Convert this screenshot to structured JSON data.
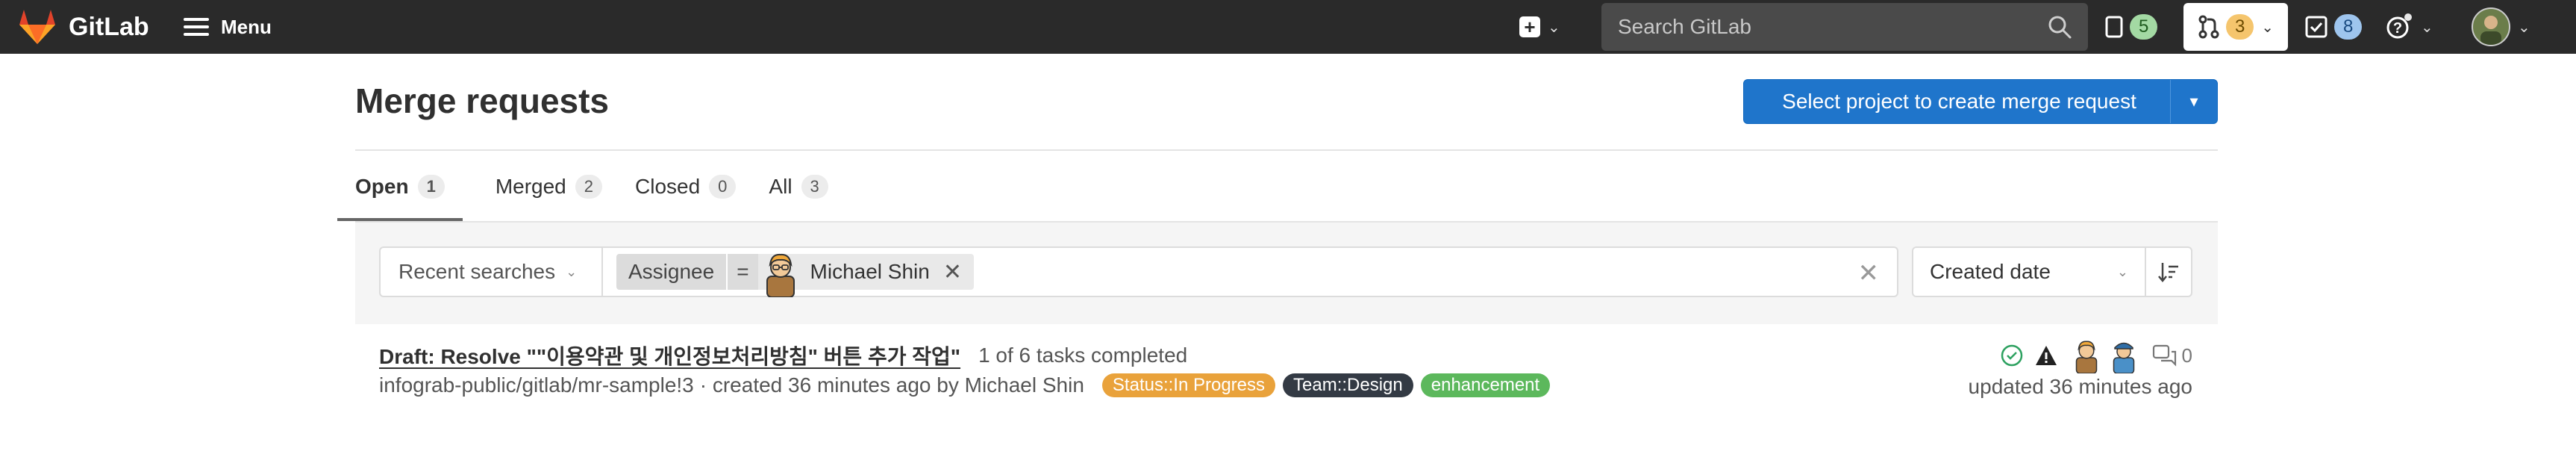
{
  "navbar": {
    "brand": "GitLab",
    "menu_label": "Menu",
    "search_placeholder": "Search GitLab",
    "issues_count": "5",
    "merge_requests_count": "3",
    "todos_count": "8",
    "colors": {
      "background": "#2a2a2a",
      "logo": "#e2432a",
      "issues_pill": "#a3d9a3",
      "mr_pill": "#f5c56d",
      "todos_pill": "#9ec5ee"
    }
  },
  "page": {
    "title": "Merge requests",
    "create_button": "Select project to create merge request",
    "accent_color": "#1f75cb"
  },
  "tabs": [
    {
      "label": "Open",
      "count": "1",
      "active": true
    },
    {
      "label": "Merged",
      "count": "2",
      "active": false
    },
    {
      "label": "Closed",
      "count": "0",
      "active": false
    },
    {
      "label": "All",
      "count": "3",
      "active": false
    }
  ],
  "filter": {
    "recent_searches": "Recent searches",
    "token_key": "Assignee",
    "token_operator": "=",
    "token_value": "Michael Shin",
    "sort_by": "Created date"
  },
  "merge_requests": [
    {
      "title": "Draft: Resolve \"\"이용약관 및 개인정보처리방침\" 버튼 추가 작업\"",
      "tasks": "1 of 6 tasks completed",
      "reference": "infograb-public/gitlab/mr-sample!3",
      "created": "· created 36 minutes ago by Michael Shin",
      "labels": [
        {
          "text": "Status::In Progress",
          "color": "#e9a23b"
        },
        {
          "text": "Team::Design",
          "color": "#333a44"
        },
        {
          "text": "enhancement",
          "color": "#5cb85c"
        }
      ],
      "comments": "0",
      "updated": "updated 36 minutes ago"
    }
  ]
}
